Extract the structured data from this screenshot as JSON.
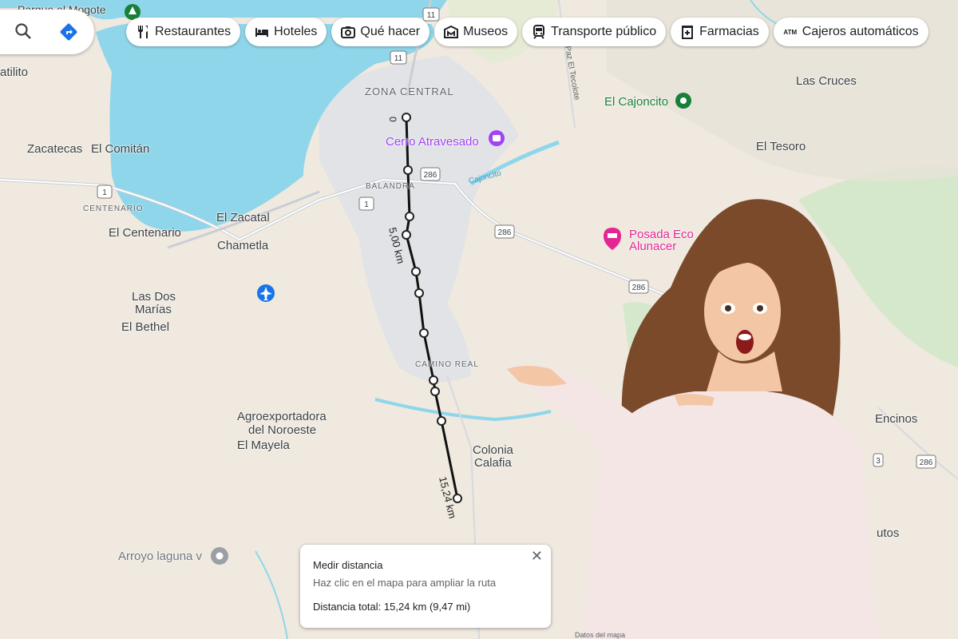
{
  "toolbar": {
    "chips": [
      {
        "label": "Restaurantes",
        "icon": "fork-knife-icon"
      },
      {
        "label": "Hoteles",
        "icon": "bed-icon"
      },
      {
        "label": "Qué hacer",
        "icon": "camera-icon"
      },
      {
        "label": "Museos",
        "icon": "museum-icon"
      },
      {
        "label": "Transporte público",
        "icon": "train-icon"
      },
      {
        "label": "Farmacias",
        "icon": "pharmacy-icon"
      },
      {
        "label": "Cajeros automáticos",
        "icon": "atm-icon"
      }
    ]
  },
  "map": {
    "places": {
      "top_left": "Parque el Mogote",
      "atilito": "atilito",
      "zacatecas": "Zacatecas",
      "el_comitan": "El Comitán",
      "centenario_small": "CENTENARIO",
      "el_centenario": "El Centenario",
      "el_zacatal": "El Zacatal",
      "chametla": "Chametla",
      "las_dos": "Las Dos",
      "marias": "Marías",
      "el_bethel": "El Bethel",
      "agro1": "Agroexportadora",
      "agro2": "del Noroeste",
      "el_mayela": "El Mayela",
      "colonia": "Colonia",
      "calafia": "Calafia",
      "arroyo": "Arroyo laguna v",
      "zona_central": "ZONA CENTRAL",
      "balandra": "BALANDRA",
      "camino_real": "CAMINO REAL",
      "cerro": "Cerro Atravesado",
      "el_cajoncito": "El Cajoncito",
      "las_cruces": "Las Cruces",
      "el_tesoro": "El Tesoro",
      "posada1": "Posada Eco",
      "posada2": "Alunacer",
      "encinos": "Encinos",
      "utos": "utos",
      "paz_el_tecolote": "Paz El Tecolote",
      "cajoncito_river": "Cajoncito"
    },
    "shields": {
      "r11a": "11",
      "r11b": "11",
      "r1a": "1",
      "r1b": "1",
      "r286a": "286",
      "r286b": "286",
      "r286c": "286",
      "r286d": "286",
      "r3": "3"
    },
    "measure": {
      "start": "0",
      "mid": "5,00 km",
      "end": "15,24 km"
    },
    "footer": "Datos del mapa"
  },
  "measure_panel": {
    "title": "Medir distancia",
    "subtitle": "Haz clic en el mapa para ampliar la ruta",
    "total": "Distancia total: 15,24 km (9,47 mi)",
    "close": "✕"
  },
  "colors": {
    "water": "#8fd6ea",
    "land": "#efe9df",
    "green": "#cfe7c6",
    "accent": "#1a73e8",
    "road": "#cfd4dc"
  }
}
